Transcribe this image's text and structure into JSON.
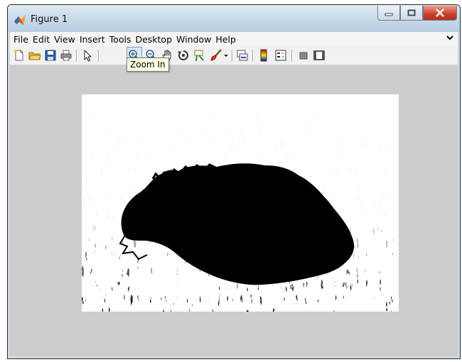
{
  "window": {
    "title": "Figure 1"
  },
  "menu": [
    "File",
    "Edit",
    "View",
    "Insert",
    "Tools",
    "Desktop",
    "Window",
    "Help"
  ],
  "toolbar": {
    "buttons": [
      "new-figure-icon",
      "open-file-icon",
      "save-icon",
      "print-icon",
      "edit-plot-icon",
      "zoom-in-icon",
      "zoom-out-icon",
      "pan-icon",
      "rotate-3d-icon",
      "data-cursor-icon",
      "brush-icon",
      "link-plot-icon",
      "colorbar-icon",
      "legend-icon",
      "hide-plot-tools-icon",
      "show-plot-tools-icon"
    ],
    "pressed": "zoom-in-icon"
  },
  "tooltip": {
    "text": "Zoom In"
  },
  "colors": {
    "titlebar": "#c6d8e8",
    "figure_background": "#cccccc",
    "close_button": "#c8412a"
  }
}
